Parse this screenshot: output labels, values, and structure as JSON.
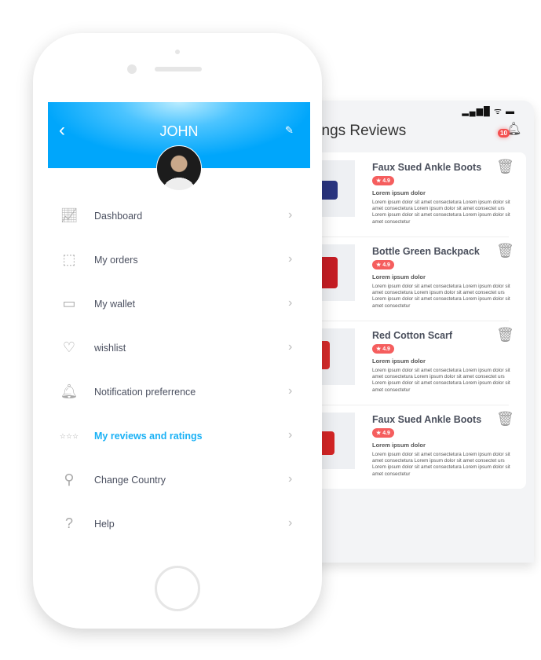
{
  "reviews_screen": {
    "status": "▂▄▆█ ᯤ ▬",
    "title": "tings Reviews",
    "notification_count": "10",
    "cards": [
      {
        "title": "Faux Sued Ankle Boots",
        "rating": "★ 4.9",
        "subtitle": "Lorem ipsum dolor",
        "body": "Lorem ipsum dolor sit amet consectetura Lorem ipsum dolor sit amet consectetura Lorem ipsum dolor sit amet consectet urs Lorem ipsum dolor sit amet consectetura Lorem ipsum dolor sit amet consectetur",
        "color": "#2a3580"
      },
      {
        "title": "Bottle Green Backpack",
        "rating": "★ 4.9",
        "subtitle": "Lorem ipsum dolor",
        "body": "Lorem ipsum dolor sit amet consectetura Lorem ipsum dolor sit amet consectetura Lorem ipsum dolor sit amet consectet urs Lorem ipsum dolor sit amet consectetura Lorem ipsum dolor sit amet consectetur",
        "color": "#c61d24"
      },
      {
        "title": "Red Cotton Scarf",
        "rating": "★ 4.9",
        "subtitle": "Lorem ipsum dolor",
        "body": "Lorem ipsum dolor sit amet consectetura Lorem ipsum dolor sit amet consectetura Lorem ipsum dolor sit amet consectet urs Lorem ipsum dolor sit amet consectetura Lorem ipsum dolor sit amet consectetur",
        "color": "#d62a2a"
      },
      {
        "title": "Faux Sued Ankle Boots",
        "rating": "★ 4.9",
        "subtitle": "Lorem ipsum dolor",
        "body": "Lorem ipsum dolor sit amet consectetura Lorem ipsum dolor sit amet consectetura Lorem ipsum dolor sit amet consectet urs Lorem ipsum dolor sit amet consectetura Lorem ipsum dolor sit amet consectetur",
        "color": "#d42525"
      }
    ]
  },
  "profile": {
    "name": "JOHN",
    "back": "‹",
    "edit": "✎",
    "menu": [
      {
        "label": "Dashboard",
        "icon": "📈︎"
      },
      {
        "label": "My orders",
        "icon": "⬚"
      },
      {
        "label": "My wallet",
        "icon": "▭"
      },
      {
        "label": "wishlist",
        "icon": "♡"
      },
      {
        "label": "Notification preferrence",
        "icon": "🔔︎"
      },
      {
        "label": "My reviews and ratings",
        "icon": "☆☆☆"
      },
      {
        "label": "Change Country",
        "icon": "⚲"
      },
      {
        "label": "Help",
        "icon": "?"
      }
    ],
    "chevron": "›",
    "accent": "#1ab1f5"
  }
}
